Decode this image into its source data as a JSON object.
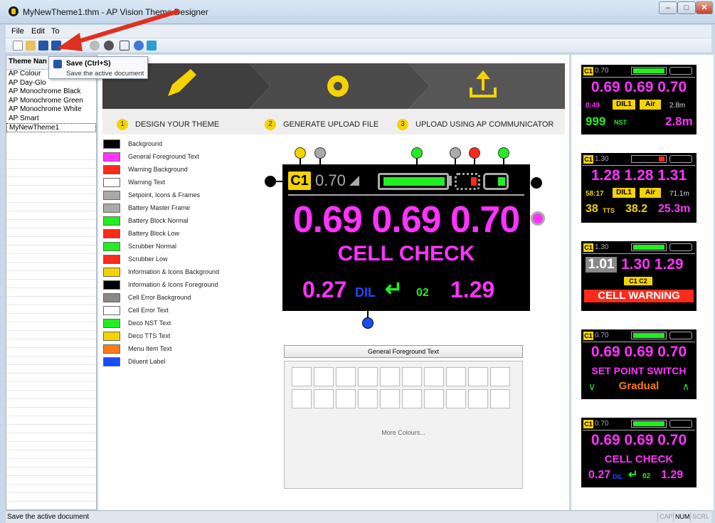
{
  "window": {
    "title": "MyNewTheme1.thm - AP Vision Theme Designer"
  },
  "menu": [
    "File",
    "Edit",
    "To"
  ],
  "tooltip": {
    "title": "Save (Ctrl+S)",
    "description": "Save the active document"
  },
  "sidebar": {
    "header": "Theme Nan",
    "items": [
      "AP Colour",
      "AP Day-Glo",
      "AP Monochrome Black",
      "AP Monochrome Green",
      "AP Monochrome White",
      "AP Smart",
      "MyNewTheme1"
    ],
    "selected": "MyNewTheme1"
  },
  "steps": [
    {
      "num": "1",
      "label": "DESIGN YOUR THEME",
      "icon": "pencil-icon"
    },
    {
      "num": "2",
      "label": "GENERATE UPLOAD FILE",
      "icon": "gear-icon"
    },
    {
      "num": "3",
      "label": "UPLOAD USING AP COMMUNICATOR",
      "icon": "upload-icon"
    }
  ],
  "legend": [
    {
      "label": "Background",
      "color": "#000000"
    },
    {
      "label": "General Foreground Text",
      "color": "#ff33ff"
    },
    {
      "label": "Warning Background",
      "color": "#ff2a1a"
    },
    {
      "label": "Warning Text",
      "color": "#ffffff"
    },
    {
      "label": "Setpoint, Icons & Frames",
      "color": "#aaaaaa"
    },
    {
      "label": "Battery Master Frame",
      "color": "#aaaaaa"
    },
    {
      "label": "Battery Block Normal",
      "color": "#22ee22"
    },
    {
      "label": "Battery Block Low",
      "color": "#ff2a1a"
    },
    {
      "label": "Scrubber Normal",
      "color": "#22ee22"
    },
    {
      "label": "Scrubber Low",
      "color": "#ff2a1a"
    },
    {
      "label": "Information & Icons Background",
      "color": "#f5d300"
    },
    {
      "label": "Information & Icons Foreground",
      "color": "#000000"
    },
    {
      "label": "Cell Error Background",
      "color": "#888888"
    },
    {
      "label": "Cell Error Text",
      "color": "#ffffff"
    },
    {
      "label": "Deco NST Text",
      "color": "#22ee22"
    },
    {
      "label": "Deco TTS Text",
      "color": "#f5d300"
    },
    {
      "label": "Menu Item Text",
      "color": "#ff7a1a"
    },
    {
      "label": "Diluent Label",
      "color": "#1a4cff"
    }
  ],
  "display": {
    "c1": "C1",
    "setpoint": "0.70",
    "ppo2": "0.69 0.69 0.70",
    "status": "CELL CHECK",
    "dil_value": "0.27",
    "dil_label": "DIL",
    "o2_label": "02",
    "o2_value": "1.29"
  },
  "palette": {
    "selected_label": "General Foreground Text",
    "more": "More Colours..."
  },
  "previews": [
    {
      "sp": "0.70",
      "ppo2": "0.69 0.69 0.70",
      "time": "0:49",
      "gas": "DIL1",
      "gas2": "Air",
      "depth": "2.8m",
      "ndl": "999",
      "ndl_label": "NST",
      "depth_big": "2.8m"
    },
    {
      "sp": "1.30",
      "ppo2": "1.28 1.28 1.31",
      "time": "58:17",
      "gas": "DIL1",
      "gas2": "Air",
      "depth": "71.1m",
      "tts": "38",
      "tts_label": "TTS",
      "v2": "38.2",
      "v3": "25.3m"
    },
    {
      "sp": "1.30",
      "cell1": "1.01",
      "cell_rest": "1.30 1.29",
      "cells": "C1 C2",
      "warning": "CELL WARNING"
    },
    {
      "sp": "0.70",
      "ppo2": "0.69 0.69 0.70",
      "msg": "SET POINT SWITCH",
      "mode": "Gradual"
    },
    {
      "sp": "0.70",
      "ppo2": "0.69 0.69 0.70",
      "msg": "CELL CHECK",
      "dil": "0.27",
      "dil_label": "DIL",
      "o2": "02",
      "o2v": "1.29"
    }
  ],
  "status": {
    "text": "Save the active document",
    "indicators": [
      "CAP",
      "NUM",
      "SCRL"
    ]
  }
}
